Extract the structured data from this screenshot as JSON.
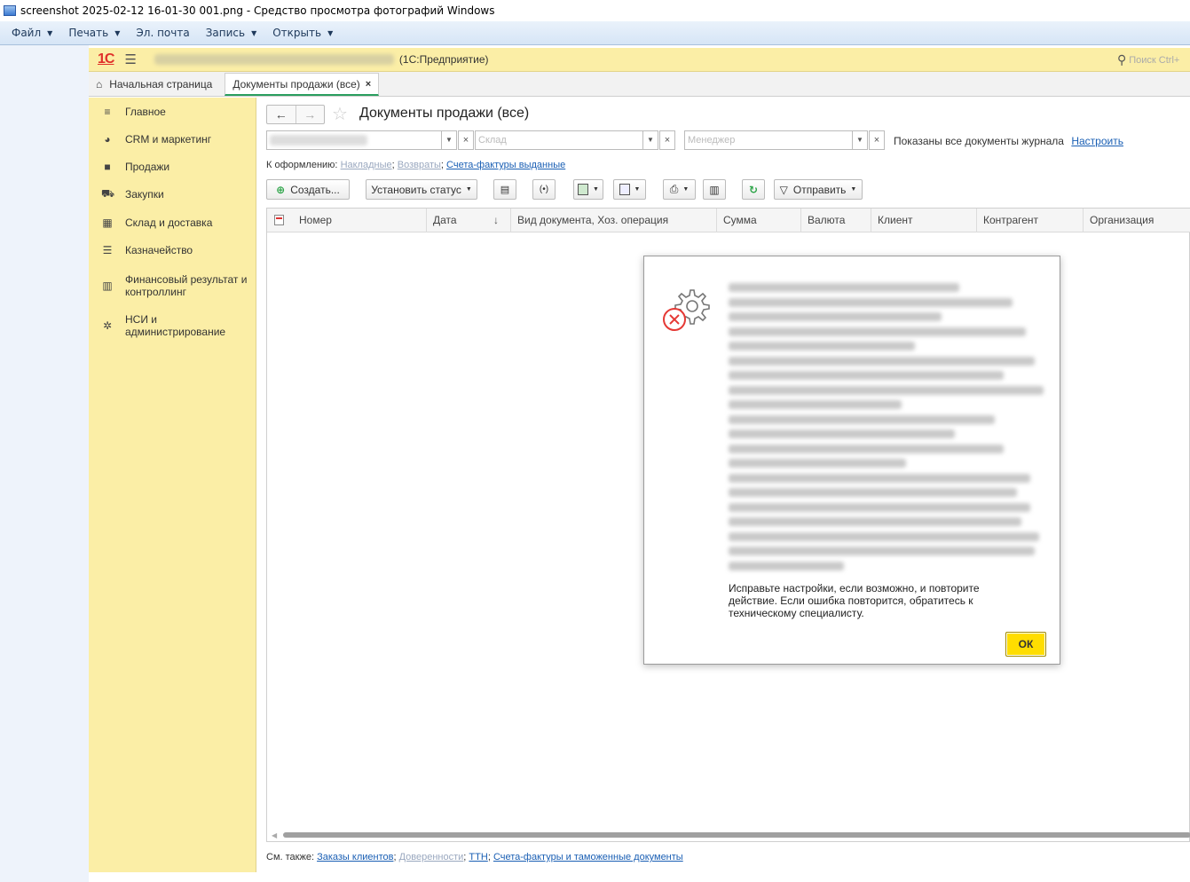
{
  "window": {
    "title": "screenshot 2025-02-12 16-01-30 001.png - Средство просмотра фотографий Windows"
  },
  "viewer_menu": [
    {
      "label": "Файл",
      "has_arrow": true
    },
    {
      "label": "Печать",
      "has_arrow": true
    },
    {
      "label": "Эл. почта",
      "has_arrow": false
    },
    {
      "label": "Запись",
      "has_arrow": true
    },
    {
      "label": "Открыть",
      "has_arrow": true
    }
  ],
  "onec": {
    "logo": "1С",
    "app_suffix": "(1С:Предприятие)",
    "search_placeholder": "Поиск Ctrl+"
  },
  "tabs": {
    "home": "Начальная страница",
    "active": "Документы продажи (все)",
    "close": "×"
  },
  "sidebar": {
    "items": [
      {
        "label": "Главное",
        "icon": "menu-icon",
        "glyph": "≡"
      },
      {
        "label": "CRM и маркетинг",
        "icon": "pie-chart-icon",
        "glyph": "◕"
      },
      {
        "label": "Продажи",
        "icon": "bag-icon",
        "glyph": "■"
      },
      {
        "label": "Закупки",
        "icon": "cart-icon",
        "glyph": "⛟"
      },
      {
        "label": "Склад и доставка",
        "icon": "warehouse-icon",
        "glyph": "▦"
      },
      {
        "label": "Казначейство",
        "icon": "coins-icon",
        "glyph": "☰"
      },
      {
        "label": "Финансовый результат и контроллинг",
        "icon": "bar-chart-icon",
        "glyph": "▥"
      },
      {
        "label": "НСИ и администрирование",
        "icon": "gear-icon",
        "glyph": "✲"
      }
    ]
  },
  "page": {
    "title": "Документы продажи (все)",
    "filters": {
      "sklad_placeholder": "Склад",
      "manager_placeholder": "Менеджер",
      "clear": "×"
    },
    "shown_text": "Показаны все документы журнала",
    "configure_link": "Настроить",
    "k_oformleniyu": {
      "prefix": "К оформлению:",
      "link1": "Накладные",
      "link2": "Возвраты",
      "link3": "Счета-фактуры выданные",
      "sep": ";"
    },
    "toolbar": {
      "create": "Создать...",
      "set_status": "Установить статус",
      "send": "Отправить"
    },
    "columns": [
      "Номер",
      "Дата",
      "Вид документа, Хоз. операция",
      "Сумма",
      "Валюта",
      "Клиент",
      "Контрагент",
      "Организация"
    ],
    "sort_arrow": "↓",
    "see_also": {
      "prefix": "См. также:",
      "link1": "Заказы клиентов",
      "link2": "Доверенности",
      "link3": "ТТН",
      "link4": "Счета-фактуры и таможенные документы"
    }
  },
  "dialog": {
    "message": "Исправьте настройки, если возможно, и повторите действие. Если ошибка повторится, обратитесь к техническому специалисту.",
    "ok": "ОК"
  }
}
